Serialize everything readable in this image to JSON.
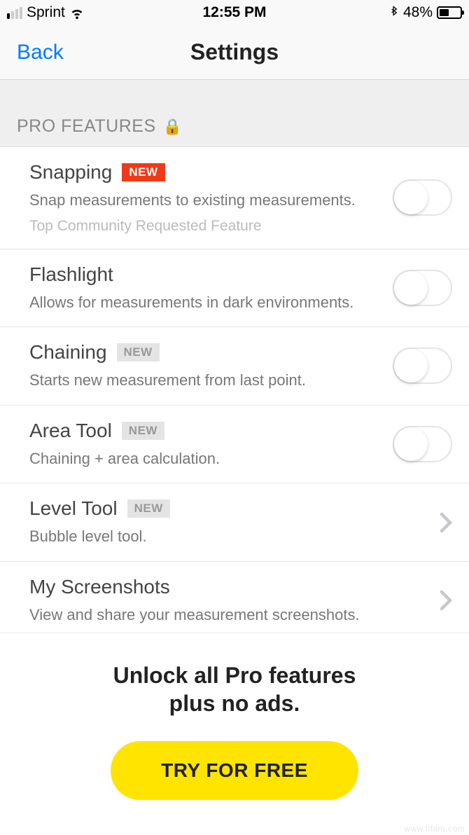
{
  "status_bar": {
    "carrier": "Sprint",
    "time": "12:55 PM",
    "battery_pct": "48%"
  },
  "nav": {
    "back": "Back",
    "title": "Settings"
  },
  "section": {
    "header": "PRO FEATURES"
  },
  "badges": {
    "new": "NEW"
  },
  "settings": {
    "snapping": {
      "title": "Snapping",
      "desc": "Snap measurements to existing measurements.",
      "sub": "Top Community Requested Feature"
    },
    "flashlight": {
      "title": "Flashlight",
      "desc": "Allows for measurements in dark environments."
    },
    "chaining": {
      "title": "Chaining",
      "desc": "Starts new measurement from last point."
    },
    "area_tool": {
      "title": "Area Tool",
      "desc": "Chaining + area calculation."
    },
    "level_tool": {
      "title": "Level Tool",
      "desc": "Bubble level tool."
    },
    "screenshots": {
      "title": "My Screenshots",
      "desc": "View and share your measurement screenshots."
    }
  },
  "promo": {
    "title": "Unlock all Pro features\nplus no ads.",
    "cta": "TRY FOR FREE"
  },
  "watermark": "www.lifam.com"
}
